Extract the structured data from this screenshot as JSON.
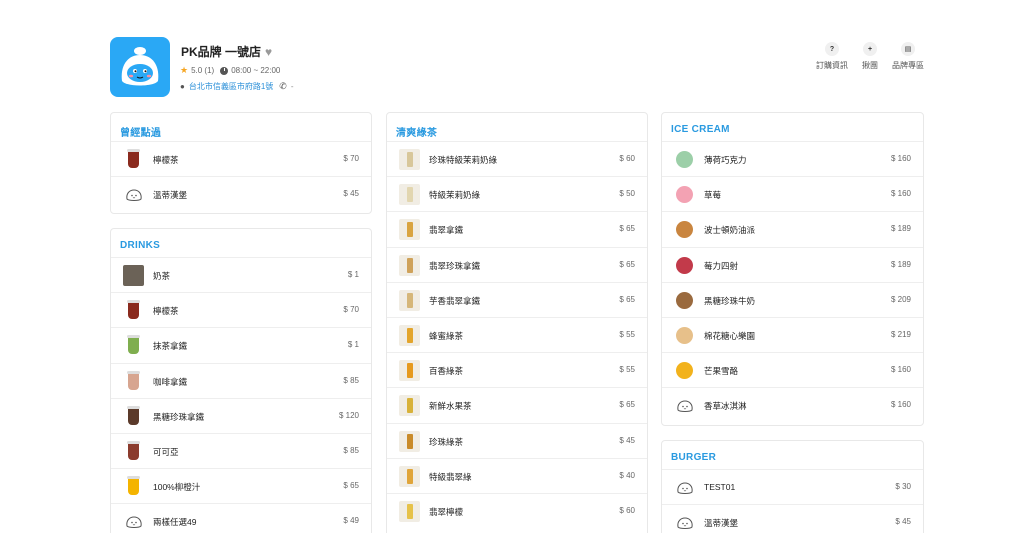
{
  "store": {
    "name": "PK品牌 一號店",
    "rating": "5.0 (1)",
    "hours": "08:00 ~ 22:00",
    "address": "台北市信義區市府路1號",
    "phone": "-"
  },
  "actions": [
    {
      "label": "訂購資訊",
      "icon": "info-icon"
    },
    {
      "label": "揪團",
      "icon": "group-icon"
    },
    {
      "label": "品牌專區",
      "icon": "store-icon"
    }
  ],
  "sections": {
    "history": {
      "title": "曾經點過",
      "items": [
        {
          "name": "檸檬茶",
          "price": "$ 70",
          "thumb": "cup",
          "color": "#8a2a1e"
        },
        {
          "name": "溫蒂漢堡",
          "price": "$ 45",
          "thumb": "mascot"
        }
      ]
    },
    "drinks": {
      "title": "DRINKS",
      "items": [
        {
          "name": "奶茶",
          "price": "$ 1",
          "thumb": "photo",
          "color": "#6b6257"
        },
        {
          "name": "檸檬茶",
          "price": "$ 70",
          "thumb": "cup",
          "color": "#8a2a1e"
        },
        {
          "name": "抹茶拿鐵",
          "price": "$ 1",
          "thumb": "cup",
          "color": "#7fae4f"
        },
        {
          "name": "咖啡拿鐵",
          "price": "$ 85",
          "thumb": "cup",
          "color": "#d7a590"
        },
        {
          "name": "黑糖珍珠拿鐵",
          "price": "$ 120",
          "thumb": "cup",
          "color": "#5b3a2a"
        },
        {
          "name": "可可亞",
          "price": "$ 85",
          "thumb": "cup",
          "color": "#8b3b2d"
        },
        {
          "name": "100%柳橙汁",
          "price": "$ 65",
          "thumb": "cup",
          "color": "#f4b400"
        },
        {
          "name": "兩樣任選49",
          "price": "$ 49",
          "thumb": "mascot"
        }
      ]
    },
    "green": {
      "title": "清爽綠茶",
      "items": [
        {
          "name": "珍珠特級茉莉奶綠",
          "price": "$ 60",
          "thumb": "bottle",
          "color": "#d8c79a"
        },
        {
          "name": "特級茉莉奶綠",
          "price": "$ 50",
          "thumb": "bottle",
          "color": "#e2d6b0"
        },
        {
          "name": "翡翠拿鐵",
          "price": "$ 65",
          "thumb": "bottle",
          "color": "#d9a441"
        },
        {
          "name": "翡翠珍珠拿鐵",
          "price": "$ 65",
          "thumb": "bottle",
          "color": "#cfa25a"
        },
        {
          "name": "芋香翡翠拿鐵",
          "price": "$ 65",
          "thumb": "bottle",
          "color": "#d6b77a"
        },
        {
          "name": "蜂蜜綠茶",
          "price": "$ 55",
          "thumb": "bottle",
          "color": "#e3a52c"
        },
        {
          "name": "百香綠茶",
          "price": "$ 55",
          "thumb": "bottle",
          "color": "#e69a1f"
        },
        {
          "name": "新鮮水果茶",
          "price": "$ 65",
          "thumb": "bottle",
          "color": "#d8b23a"
        },
        {
          "name": "珍珠綠茶",
          "price": "$ 45",
          "thumb": "bottle",
          "color": "#c98b2a"
        },
        {
          "name": "特級翡翠綠",
          "price": "$ 40",
          "thumb": "bottle",
          "color": "#e0a53a"
        },
        {
          "name": "翡翠檸檬",
          "price": "$ 60",
          "thumb": "bottle",
          "color": "#e6c24a"
        }
      ]
    },
    "icecream": {
      "title": "ICE CREAM",
      "items": [
        {
          "name": "薄荷巧克力",
          "price": "$ 160",
          "thumb": "scoop",
          "color": "#9ccfa8"
        },
        {
          "name": "草莓",
          "price": "$ 160",
          "thumb": "scoop",
          "color": "#f3a2b3"
        },
        {
          "name": "波士頓奶油派",
          "price": "$ 189",
          "thumb": "scoop",
          "color": "#c9853f"
        },
        {
          "name": "莓力四射",
          "price": "$ 189",
          "thumb": "scoop",
          "color": "#c23a4a"
        },
        {
          "name": "黑糖珍珠牛奶",
          "price": "$ 209",
          "thumb": "scoop",
          "color": "#9a6a3e"
        },
        {
          "name": "棉花糖心樂園",
          "price": "$ 219",
          "thumb": "scoop",
          "color": "#e7c08a"
        },
        {
          "name": "芒果雪酪",
          "price": "$ 160",
          "thumb": "scoop",
          "color": "#f2b21c"
        },
        {
          "name": "香草冰淇淋",
          "price": "$ 160",
          "thumb": "mascot"
        }
      ]
    },
    "burger": {
      "title": "BURGER",
      "items": [
        {
          "name": "TEST01",
          "price": "$ 30",
          "thumb": "mascot"
        },
        {
          "name": "溫蒂漢堡",
          "price": "$ 45",
          "thumb": "mascot"
        }
      ]
    }
  }
}
